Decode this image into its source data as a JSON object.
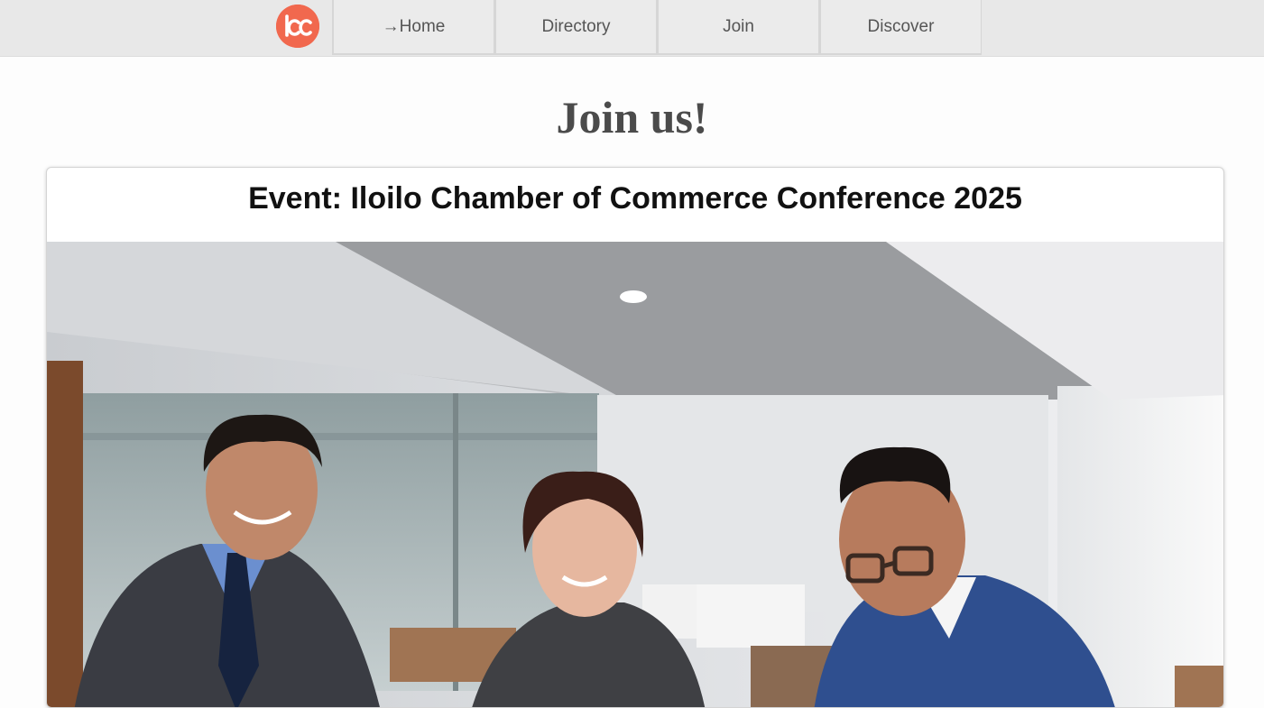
{
  "header": {
    "logo_text": "Icc",
    "nav": [
      {
        "label": "→Home"
      },
      {
        "label": "Directory"
      },
      {
        "label": "Join"
      },
      {
        "label": "Discover"
      }
    ]
  },
  "main": {
    "title": "Join us!",
    "event": {
      "title": "Event: Iloilo Chamber of Commerce Conference 2025"
    }
  },
  "colors": {
    "logo": "#f1684e",
    "nav_background": "#e8e8e8",
    "title": "#4b4b4b"
  }
}
